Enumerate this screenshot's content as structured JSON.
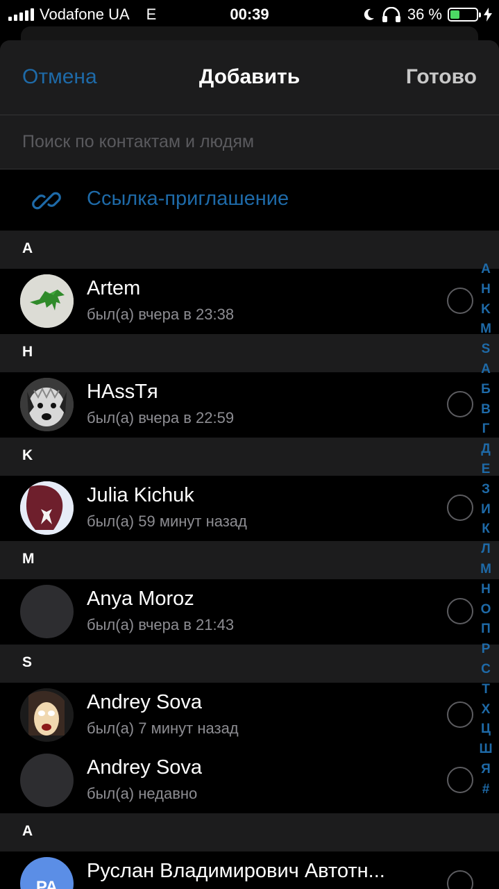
{
  "status_bar": {
    "carrier": "Vodafone UA",
    "network": "E",
    "time": "00:39",
    "battery_percent_text": "36 %",
    "battery_level": 0.36,
    "icons": [
      "signal-icon",
      "moon-icon",
      "headphones-icon",
      "battery-icon",
      "charging-bolt-icon"
    ]
  },
  "nav": {
    "cancel_label": "Отмена",
    "title": "Добавить",
    "done_label": "Готово"
  },
  "search": {
    "placeholder": "Поиск по контактам и людям",
    "value": ""
  },
  "invite": {
    "icon": "link-icon",
    "label": "Ссылка-приглашение"
  },
  "sections": [
    {
      "letter": "A"
    },
    {
      "letter": "H"
    },
    {
      "letter": "K"
    },
    {
      "letter": "M"
    },
    {
      "letter": "S"
    },
    {
      "letter": "А"
    }
  ],
  "contacts": [
    {
      "name": "Artem",
      "status": "был(а) вчера в 23:38",
      "avatar": "photo-green-dinosaur",
      "selected": false
    },
    {
      "name": "HAssTя",
      "status": "был(а) вчера в 22:59",
      "avatar": "photo-dog",
      "selected": false
    },
    {
      "name": "Julia Kichuk",
      "status": "был(а) 59 минут назад",
      "avatar": "photo-hair-bow",
      "selected": false
    },
    {
      "name": "Anya Moroz",
      "status": "был(а) вчера в 21:43",
      "avatar": "empty",
      "selected": false
    },
    {
      "name": "Andrey Sova",
      "status": "был(а) 7 минут назад",
      "avatar": "photo-cartoon-face",
      "selected": false
    },
    {
      "name": "Andrey Sova",
      "status": "был(а) недавно",
      "avatar": "empty",
      "selected": false
    },
    {
      "name": "Руслан Владимирович Автотн...",
      "status": "",
      "avatar": "initials",
      "initials": "РА",
      "selected": false
    }
  ],
  "index_letters": [
    "A",
    "H",
    "K",
    "M",
    "S",
    "А",
    "Б",
    "В",
    "Г",
    "Д",
    "Е",
    "З",
    "И",
    "К",
    "Л",
    "М",
    "Н",
    "О",
    "П",
    "Р",
    "С",
    "Т",
    "Х",
    "Ц",
    "Ш",
    "Я",
    "#"
  ],
  "colors": {
    "accent": "#1e6aa8",
    "background": "#000000",
    "sheet": "#1c1c1d",
    "secondary_text": "#8d8d92",
    "battery_green": "#4cd964"
  }
}
